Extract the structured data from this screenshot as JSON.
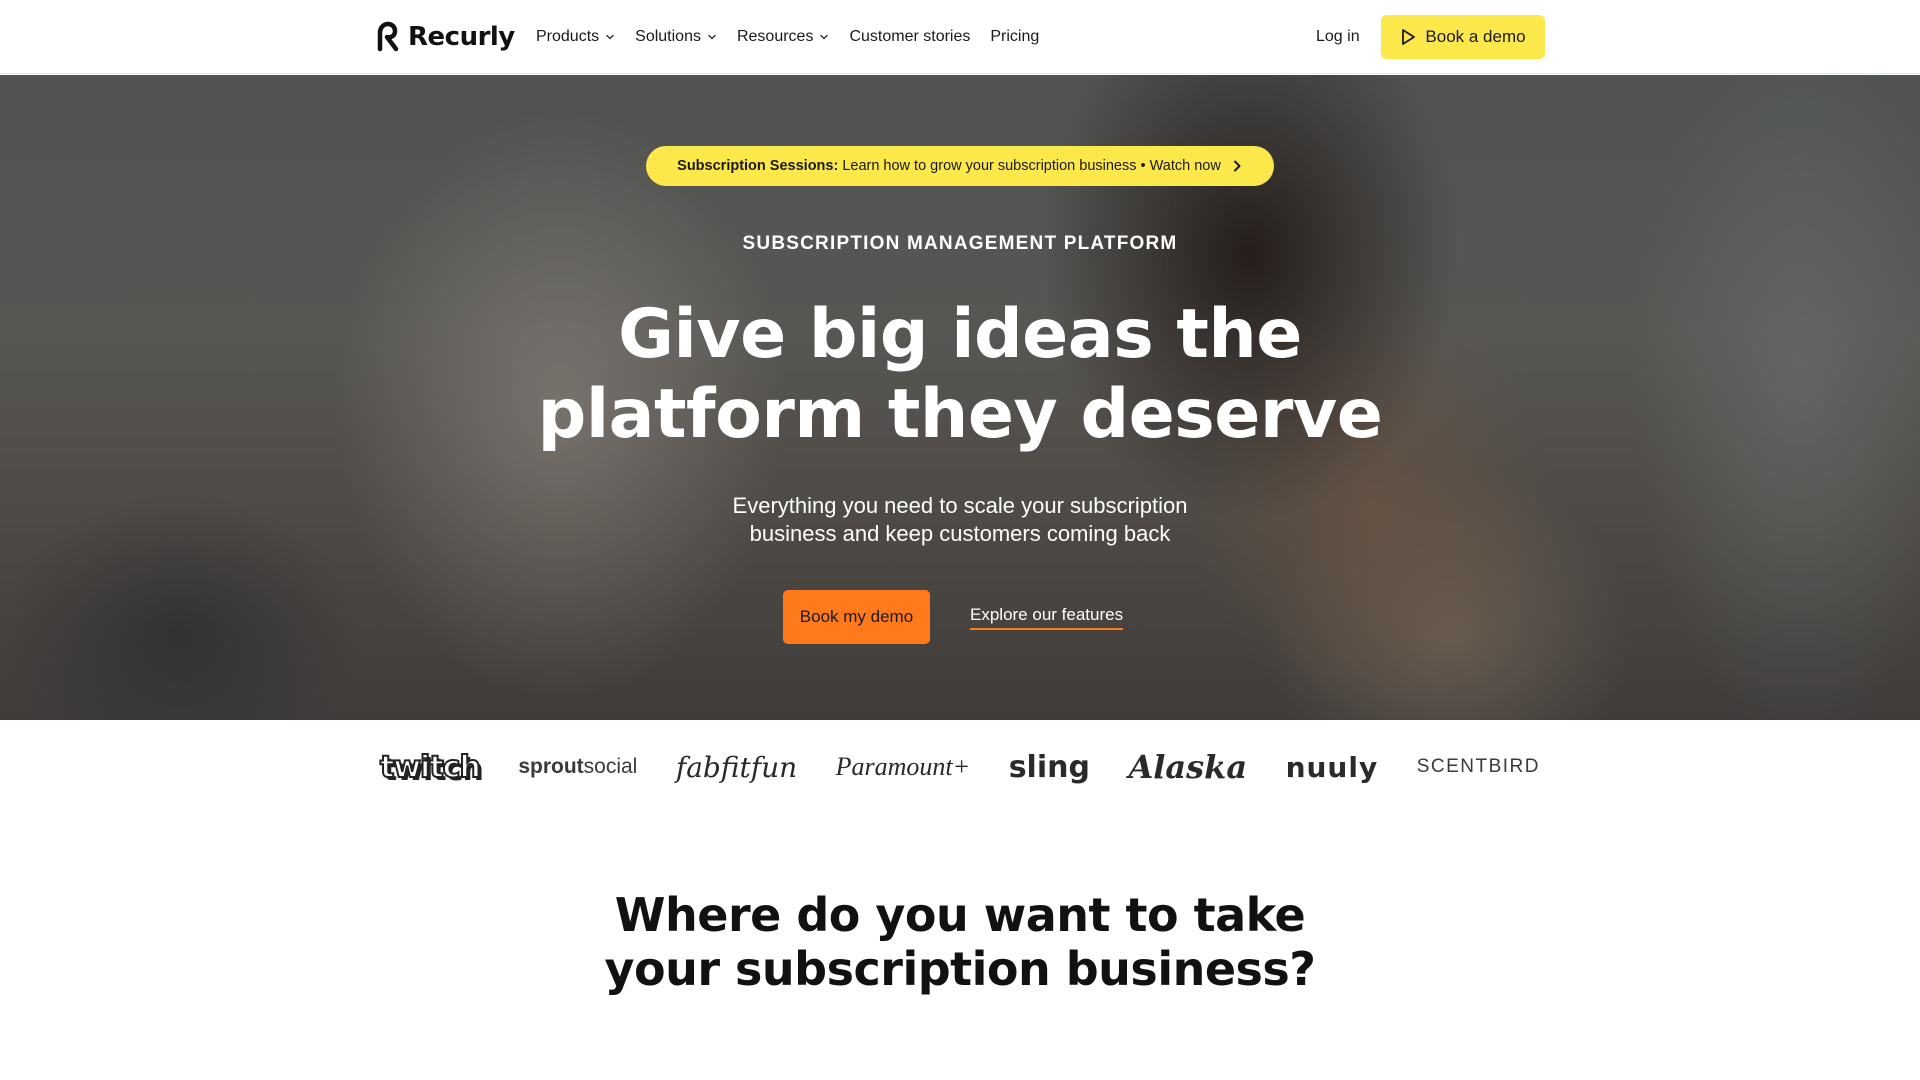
{
  "nav": {
    "logo_text": "Recurly",
    "items": [
      {
        "label": "Products",
        "dropdown": true
      },
      {
        "label": "Solutions",
        "dropdown": true
      },
      {
        "label": "Resources",
        "dropdown": true
      },
      {
        "label": "Customer stories",
        "dropdown": false
      },
      {
        "label": "Pricing",
        "dropdown": false
      }
    ],
    "login_label": "Log in",
    "book_demo_label": "Book a demo"
  },
  "hero": {
    "announcement_bold": "Subscription Sessions:",
    "announcement_text": "Learn how to grow your subscription business • Watch now",
    "eyebrow": "SUBSCRIPTION MANAGEMENT PLATFORM",
    "headline_line1": "Give big ideas the",
    "headline_line2": "platform they deserve",
    "subhead_line1": "Everything you need to scale your subscription",
    "subhead_line2": "business and keep customers coming back",
    "primary_cta": "Book my demo",
    "secondary_cta": "Explore our features"
  },
  "customer_logos": {
    "twitch": "twitch",
    "sprout_bold": "sprout",
    "sprout_rest": "social",
    "fabfitfun": "fabfitfun",
    "paramount": "Paramount+",
    "sling": "sling",
    "alaska": "Alaska",
    "nuuly": "nuuly",
    "scentbird": "SCENTBIRD"
  },
  "section": {
    "title_line1": "Where do you want to take",
    "title_line2": "your subscription business?"
  },
  "colors": {
    "accent_yellow": "#fde84b",
    "accent_orange": "#ff7a1a",
    "text_dark": "#1a1a1a"
  }
}
